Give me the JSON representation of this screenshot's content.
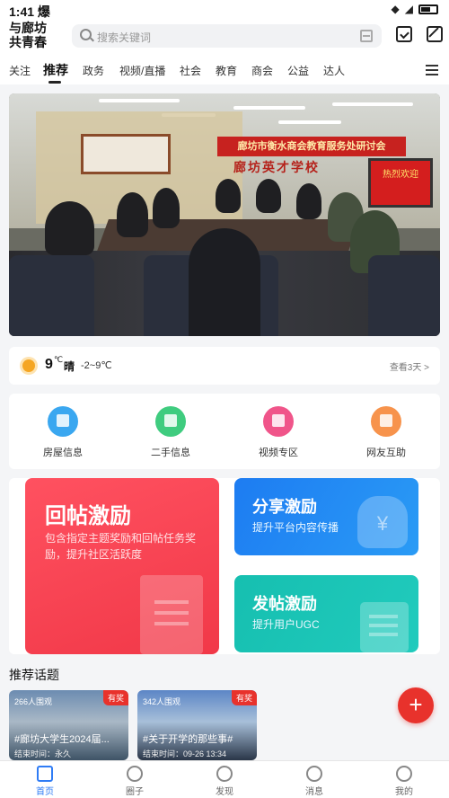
{
  "status_bar": {
    "time": "1:41",
    "indicator": "爆"
  },
  "header": {
    "logo_line1": "与廊坊",
    "logo_line2": "共青春",
    "search_placeholder": "搜索关键词"
  },
  "nav": {
    "tabs": [
      "关注",
      "推荐",
      "政务",
      "视频/直播",
      "社会",
      "教育",
      "商会",
      "公益",
      "达人"
    ],
    "active_index": 1
  },
  "banner": {
    "strip_text": "廊坊市衡水商会教育服务处研讨会",
    "school_text": "廊坊英才学校",
    "screen_text": "热烈欢迎"
  },
  "weather": {
    "temp": "9",
    "unit": "℃",
    "condition": "晴",
    "range": "-2~9℃",
    "more": "查看3天 >"
  },
  "shortcuts": [
    {
      "label": "房屋信息",
      "color": "#3aa7f0"
    },
    {
      "label": "二手信息",
      "color": "#3fcc7f"
    },
    {
      "label": "视频专区",
      "color": "#f0558a"
    },
    {
      "label": "网友互助",
      "color": "#f7934c"
    }
  ],
  "promo": {
    "reply": {
      "title": "回帖激励",
      "desc": "包含指定主题奖励和回帖任务奖励，提升社区活跃度"
    },
    "share": {
      "title": "分享激励",
      "sub": "提升平台内容传播",
      "icon_symbol": "¥"
    },
    "post": {
      "title": "发帖激励",
      "sub": "提升用户UGC"
    }
  },
  "topics": {
    "title": "推荐话题",
    "items": [
      {
        "views": "266人围观",
        "badge": "有奖",
        "name": "#廊坊大学生2024届...",
        "end": "结束时间：永久"
      },
      {
        "views": "342人围观",
        "badge": "有奖",
        "name": "#关于开学的那些事#",
        "end": "结束时间：09-26 13:34"
      }
    ]
  },
  "fab": {
    "symbol": "+"
  },
  "tabbar": {
    "items": [
      "首页",
      "圈子",
      "发现",
      "消息",
      "我的"
    ],
    "active_index": 0
  }
}
